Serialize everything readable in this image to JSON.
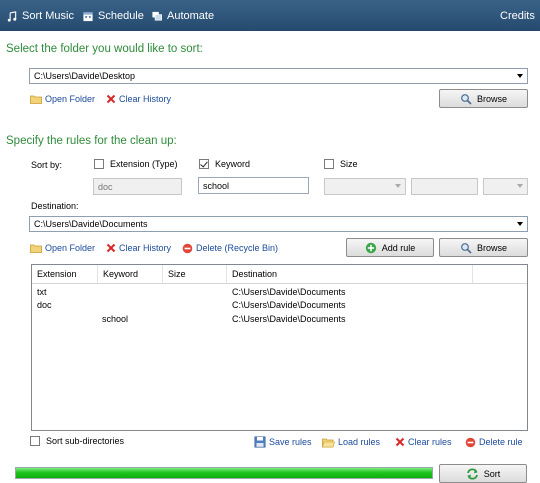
{
  "toolbar": {
    "sort_music": "Sort Music",
    "schedule": "Schedule",
    "automate": "Automate",
    "credits": "Credits"
  },
  "folder_section": {
    "title": "Select the folder you would like to sort:",
    "path": "C:\\Users\\Davide\\Desktop",
    "open_folder": "Open Folder",
    "clear_history": "Clear History",
    "browse": "Browse"
  },
  "rules_section": {
    "title": "Specify the rules for the clean up:",
    "sort_by": "Sort by:",
    "extension_label": "Extension (Type)",
    "extension_checked": false,
    "extension_value": "doc",
    "keyword_label": "Keyword",
    "keyword_checked": true,
    "keyword_value": "school",
    "size_label": "Size",
    "size_checked": false,
    "destination_label": "Destination:",
    "destination_path": "C:\\Users\\Davide\\Documents",
    "open_folder": "Open Folder",
    "clear_history": "Clear History",
    "delete": "Delete (Recycle Bin)",
    "add_rule": "Add rule",
    "browse": "Browse"
  },
  "rules_table": {
    "columns": [
      "Extension",
      "Keyword",
      "Size",
      "Destination"
    ],
    "rows": [
      {
        "extension": "txt",
        "keyword": "",
        "size": "",
        "destination": "C:\\Users\\Davide\\Documents"
      },
      {
        "extension": "doc",
        "keyword": "",
        "size": "",
        "destination": "C:\\Users\\Davide\\Documents"
      },
      {
        "extension": "",
        "keyword": "school",
        "size": "",
        "destination": "C:\\Users\\Davide\\Documents"
      }
    ]
  },
  "footer": {
    "sort_subdirs": "Sort sub-directories",
    "sort_subdirs_checked": false,
    "save_rules": "Save rules",
    "load_rules": "Load rules",
    "clear_rules": "Clear rules",
    "delete_rule": "Delete rule",
    "sort": "Sort",
    "progress": 1.0
  },
  "colors": {
    "toolbar_bg": "#2e5579",
    "section_title": "#2e8b3a",
    "link": "#1b4a9a",
    "progress_fill": "#1ec61e"
  }
}
